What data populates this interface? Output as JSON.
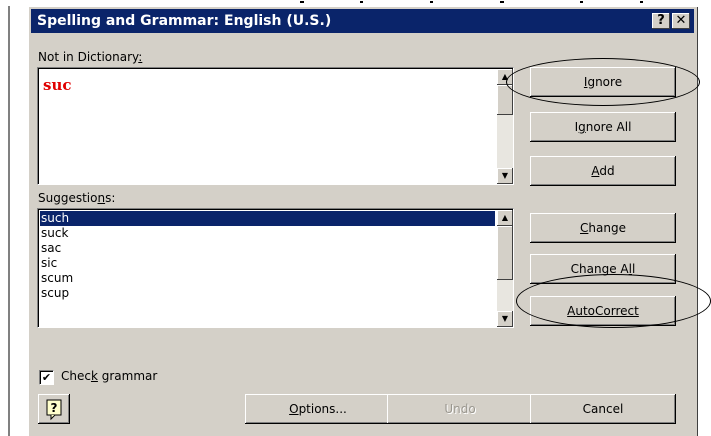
{
  "window": {
    "title": "Spelling and Grammar: English (U.S.)",
    "help_glyph": "?",
    "close_glyph": "✕"
  },
  "not_in_dictionary": {
    "label_prefix": "Not in Dictionary",
    "label_mnemonic": ":",
    "word": "suc"
  },
  "suggestions": {
    "label_prefix": "Suggestio",
    "label_mnemonic": "n",
    "label_suffix": "s:",
    "items": [
      "such",
      "suck",
      "sac",
      "sic",
      "scum",
      "scup"
    ],
    "selected": "such"
  },
  "buttons": {
    "ignore": {
      "pre": "",
      "mn": "I",
      "post": "gnore"
    },
    "ignore_all": {
      "pre": "I",
      "mn": "g",
      "post": "nore All"
    },
    "add": {
      "pre": "",
      "mn": "A",
      "post": "dd"
    },
    "change": {
      "pre": "",
      "mn": "C",
      "post": "hange"
    },
    "change_all": {
      "pre": "Change A",
      "mn": "l",
      "post": "l"
    },
    "autocorrect": {
      "pre": "AutoCorrect",
      "mn": "",
      "post": ""
    },
    "options": {
      "pre": "",
      "mn": "O",
      "post": "ptions..."
    },
    "undo": {
      "pre": "Undo",
      "mn": "",
      "post": ""
    },
    "cancel": {
      "pre": "Cancel",
      "mn": "",
      "post": ""
    }
  },
  "check_grammar": {
    "checked": "✔",
    "label_pre": "Chec",
    "label_mn": "k",
    "label_post": " grammar"
  },
  "icons": {
    "help_icon": "question-mark-icon",
    "scroll_up": "▲",
    "scroll_down": "▼"
  }
}
